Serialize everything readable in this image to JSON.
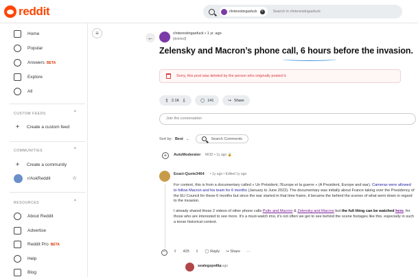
{
  "header": {
    "logo_text": "reddit",
    "search_chip": "r/interestingasfuck",
    "search_placeholder": "Search in r/interestingasfuck"
  },
  "sidebar": {
    "items": [
      {
        "label": "Home",
        "icon": "home-icon"
      },
      {
        "label": "Popular",
        "icon": "popular-icon"
      },
      {
        "label": "Answers",
        "badge": "BETA",
        "icon": "answers-icon"
      },
      {
        "label": "Explore",
        "icon": "explore-icon"
      },
      {
        "label": "All",
        "icon": "all-icon"
      }
    ],
    "custom_feeds": {
      "title": "CUSTOM FEEDS",
      "create": "Create a custom feed"
    },
    "communities": {
      "title": "COMMUNITIES",
      "create": "Create a community",
      "sub": "r/AskReddit"
    },
    "resources": {
      "title": "RESOURCES",
      "items": [
        {
          "label": "About Reddit"
        },
        {
          "label": "Advertise"
        },
        {
          "label": "Reddit Pro",
          "badge": "BETA"
        },
        {
          "label": "Help"
        },
        {
          "label": "Blog"
        }
      ]
    }
  },
  "post": {
    "subreddit": "r/interestingasfuck",
    "time": "• 1 yr. ago",
    "author": "[deleted]",
    "title": "Zelensky and Macron’s phone call, 6 hours before the invasion.",
    "deleted_notice": "Sorry, this post was deleted by the person who originally posted it.",
    "votes": "2.1K",
    "comments": "141",
    "share": "Share"
  },
  "join_placeholder": "Join the conversation",
  "sort": {
    "label": "Sort by:",
    "value": "Best",
    "search": "Search Comments"
  },
  "mod_comment": {
    "author": "AutoModerator",
    "tag": "MOD",
    "time": "• 1y ago"
  },
  "comment": {
    "author": "Exact-Quote3464",
    "meta": "• 1y ago • Edited 1y ago",
    "para1_a": "For context, this is from a documentary called « Un Président, l'Europe et la guerre » (A President, Europe and war). ",
    "para1_hl": "Cameras were allowed to follow Macron and his team for 6 months",
    "para1_b": " (January to June 2022). The documentary was initially about France taking over the Presidency of the EU Council for these 6 months but since the war started in that time frame, it became the behind the scenes of what went down in regard to the invasion.",
    "para2_a": "I already shared these 2 videos of other phone calls ",
    "link1": "Putin and Macron",
    "para2_amp": " & ",
    "link2": "Zelensky and Macron",
    "para2_b": " but ",
    "bold1": "the full thing can be watched ",
    "link3": "here",
    "para2_c": ", for those who are interested to see more. It's a must-watch imo, it's not often we get to see behind the scene footages like this, especially in such a tense historical context.",
    "votes": "425",
    "reply": "Reply",
    "share": "Share"
  },
  "reply": {
    "author": "sealegspolka",
    "time": "• 1y ago"
  }
}
